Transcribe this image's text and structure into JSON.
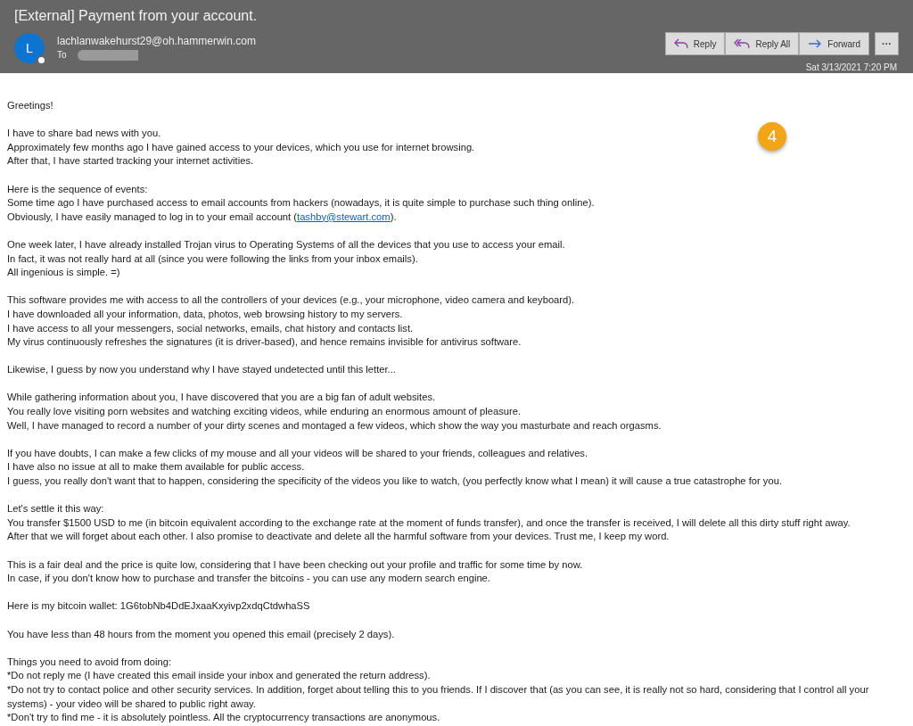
{
  "email": {
    "subject": "[External] Payment from your account.",
    "sender_initial": "L",
    "sender_online": true,
    "sender": "lachlanwakehurst29@oh.hammerwin.com",
    "to_label": "To",
    "date": "Sat 3/13/2021 7:20 PM"
  },
  "actions": [
    {
      "kind": "reply",
      "label": "Reply"
    },
    {
      "kind": "reply-all",
      "label": "Reply All"
    },
    {
      "kind": "forward",
      "label": "Forward"
    },
    {
      "kind": "more",
      "label": "···"
    }
  ],
  "badge": "4",
  "body": [
    [
      "Greetings!"
    ],
    [
      "I have to share bad news with you.",
      "Approximately few months ago I have gained access to your devices, which you use for internet browsing.",
      "After that, I have started tracking your internet activities."
    ],
    [
      "Here is the sequence of events:",
      "Some time ago I have purchased access to email accounts from hackers (nowadays, it is quite simple to purchase such thing online).",
      {
        "before": "Obviously, I have easily managed to log in to your email account (",
        "link": "tashby@stewart.com",
        "after": ")."
      }
    ],
    [
      "One week later, I have already installed Trojan virus to Operating Systems of all the devices that you use to access your email.",
      "In fact, it was not really hard at all (since you were following the links from your inbox emails).",
      "All ingenious is simple. =)"
    ],
    [
      "This software provides me with access to all the controllers of your devices (e.g., your microphone, video camera and keyboard).",
      "I have downloaded all your information, data, photos, web browsing history to my servers.",
      "I have access to all your messengers, social networks, emails, chat history and contacts list.",
      "My virus continuously refreshes the signatures (it is driver-based), and hence remains invisible for antivirus software."
    ],
    [
      "Likewise, I guess by now you understand why I have stayed undetected until this letter..."
    ],
    [
      "While gathering information about you, I have discovered that you are a big fan of adult websites.",
      "You really love visiting porn websites and watching exciting videos, while enduring an enormous amount of pleasure.",
      "Well, I have managed to record a number of your dirty scenes and montaged a few videos, which show the way you masturbate and reach orgasms."
    ],
    [
      "If you have doubts, I can make a few clicks of my mouse and all your videos will be shared to your friends, colleagues and relatives.",
      "I have also no issue at all to make them available for public access.",
      "I guess, you really don't want that to happen, considering the specificity of the videos you like to watch, (you perfectly know what I mean) it will cause a true catastrophe for you."
    ],
    [
      "Let's settle it this way:",
      "You transfer $1500 USD to me (in bitcoin equivalent according to the exchange rate at the moment of funds transfer), and once the transfer is received, I will delete all this dirty stuff right away.",
      "After that we will forget about each other. I also promise to deactivate and delete all the harmful software from your devices. Trust me, I keep my word."
    ],
    [
      "This is a fair deal and the price is quite low, considering that I have been checking out your profile and traffic for some time by now.",
      "In case, if you don't know how to purchase and transfer the bitcoins - you can use any modern search engine."
    ],
    [
      "Here is my bitcoin wallet: 1G6tobNb4DdEJxaaKxyivp2xdqCtdwhaSS"
    ],
    [
      "You have less than 48 hours from the moment you opened this email (precisely 2 days)."
    ],
    [
      "Things you need to avoid from doing:",
      "*Do not reply me (I have created this email inside your inbox and generated the return address).",
      "*Do not try to contact police and other security services. In addition, forget about telling this to you friends. If I discover that (as you can see, it is really not so hard, considering that I control all your systems) - your video will be shared to public right away.",
      "*Don't try to find me - it is absolutely pointless. All the cryptocurrency transactions are anonymous."
    ]
  ]
}
